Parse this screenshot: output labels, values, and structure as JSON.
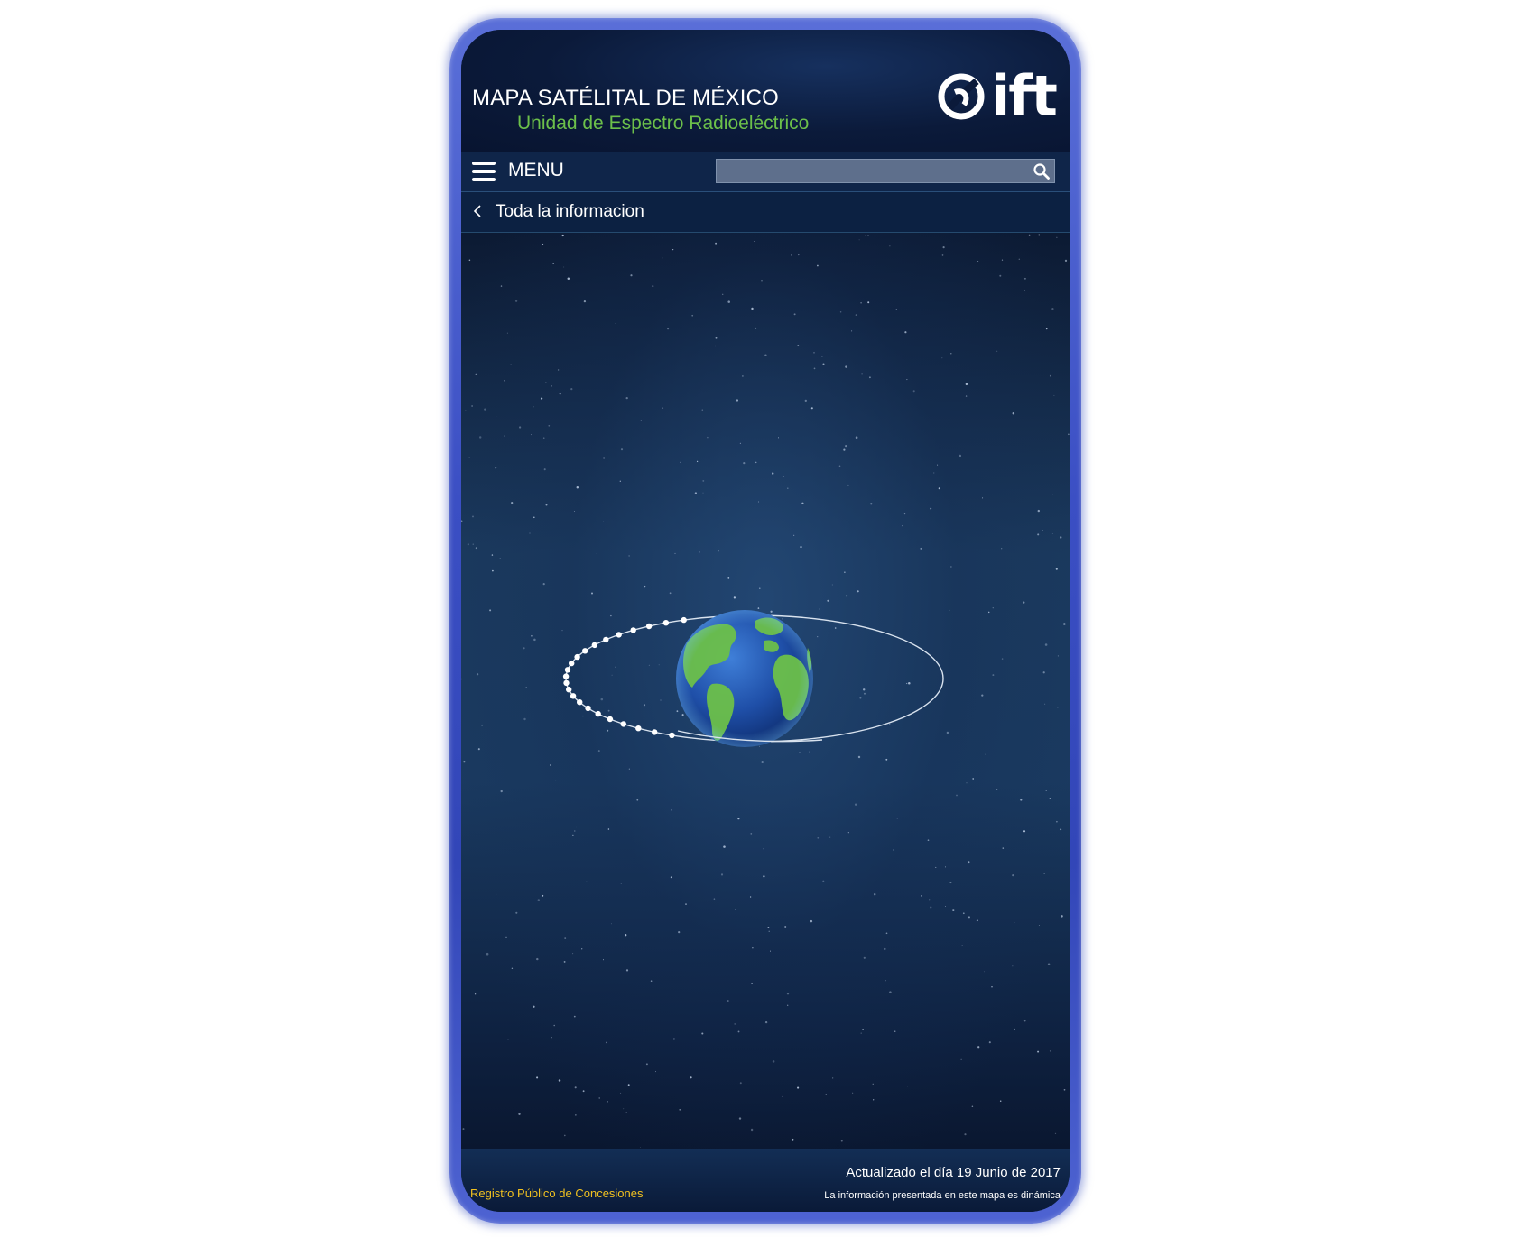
{
  "header": {
    "title": "MAPA SATÉLITAL DE MÉXICO",
    "subtitle": "Unidad de Espectro Radioeléctrico",
    "logo_text": "ift",
    "logo_icon": "ift-logo-icon"
  },
  "menubar": {
    "menu_icon": "hamburger-icon",
    "menu_label": "MENU",
    "search": {
      "value": "",
      "placeholder": "",
      "icon": "search-icon"
    }
  },
  "breadcrumb": {
    "back_icon": "chevron-left-icon",
    "label": "Toda la informacion"
  },
  "scene": {
    "globe_icon": "earth-globe",
    "orbit": "satellite-orbit-ellipse"
  },
  "footer": {
    "link_label": "Registro Público de Concesiones",
    "updated": "Actualizado  el día 19  Junio de 2017",
    "note": "La información presentada en este mapa es dinámica"
  },
  "colors": {
    "accent_green": "#6cc04a",
    "link_yellow": "#f0c020",
    "frame_blue": "#3b4fc4",
    "header_navy": "#0b1a3a"
  }
}
